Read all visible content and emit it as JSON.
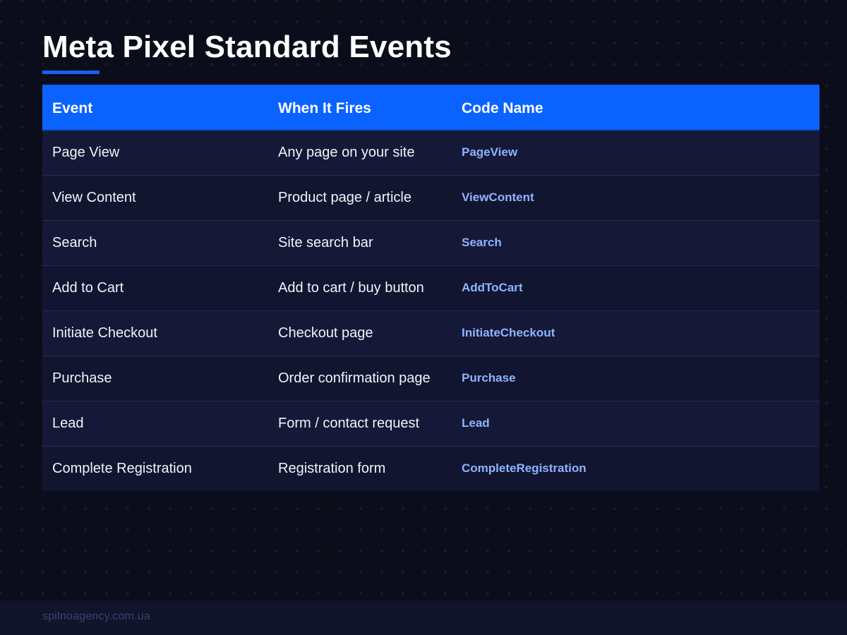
{
  "title": "Meta Pixel Standard Events",
  "colors": {
    "accent": "#0a63ff",
    "code_text": "#8db4ff",
    "background": "#0c0d1a"
  },
  "table": {
    "headers": [
      "Event",
      "When It Fires",
      "Code Name"
    ],
    "rows": [
      {
        "event": "Page View",
        "when": "Any page on your site",
        "code": "PageView"
      },
      {
        "event": "View Content",
        "when": "Product page / article",
        "code": "ViewContent"
      },
      {
        "event": "Search",
        "when": "Site search bar",
        "code": "Search"
      },
      {
        "event": "Add to Cart",
        "when": "Add to cart / buy button",
        "code": "AddToCart"
      },
      {
        "event": "Initiate Checkout",
        "when": "Checkout page",
        "code": "InitiateCheckout"
      },
      {
        "event": "Purchase",
        "when": "Order confirmation page",
        "code": "Purchase"
      },
      {
        "event": "Lead",
        "when": "Form / contact request",
        "code": "Lead"
      },
      {
        "event": "Complete Registration",
        "when": "Registration form",
        "code": "CompleteRegistration"
      }
    ]
  },
  "footer": {
    "text": "spilnoagency.com.ua"
  }
}
